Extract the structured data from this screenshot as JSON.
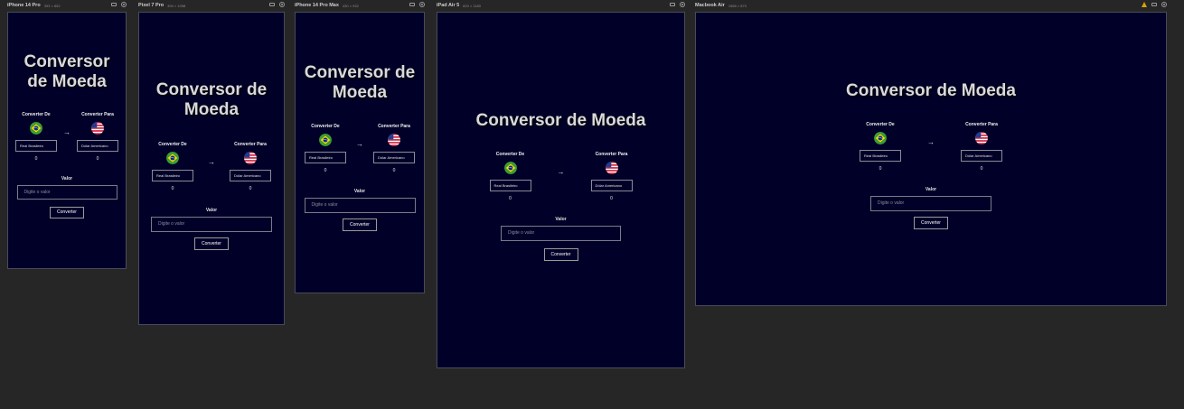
{
  "ui": {
    "title": "Conversor de Moeda",
    "from_label": "Converter De",
    "to_label": "Converter Para",
    "from_currency": "Real Brasileiro",
    "to_currency": "Dólar Americano",
    "from_result": "0",
    "to_result": "0",
    "arrow": "→",
    "value_label": "Valor",
    "input_placeholder": "Digite o valor",
    "button_label": "Converter",
    "from_flag_icon": "brazil-flag-icon",
    "to_flag_icon": "usa-flag-icon"
  },
  "devices": [
    {
      "name": "iPhone 14 Pro",
      "size": "393 × 852"
    },
    {
      "name": "Pixel 7 Pro",
      "size": "390 × 1058"
    },
    {
      "name": "iPhone 14 Pro Max",
      "size": "430 × 932"
    },
    {
      "name": "iPad Air 5",
      "size": "820 × 1180"
    },
    {
      "name": "Macbook Air",
      "size": "1568 × 870"
    }
  ],
  "colors": {
    "page_bg": "#262626",
    "screen_bg": "#010028",
    "title_text": "#d9d9d9"
  }
}
